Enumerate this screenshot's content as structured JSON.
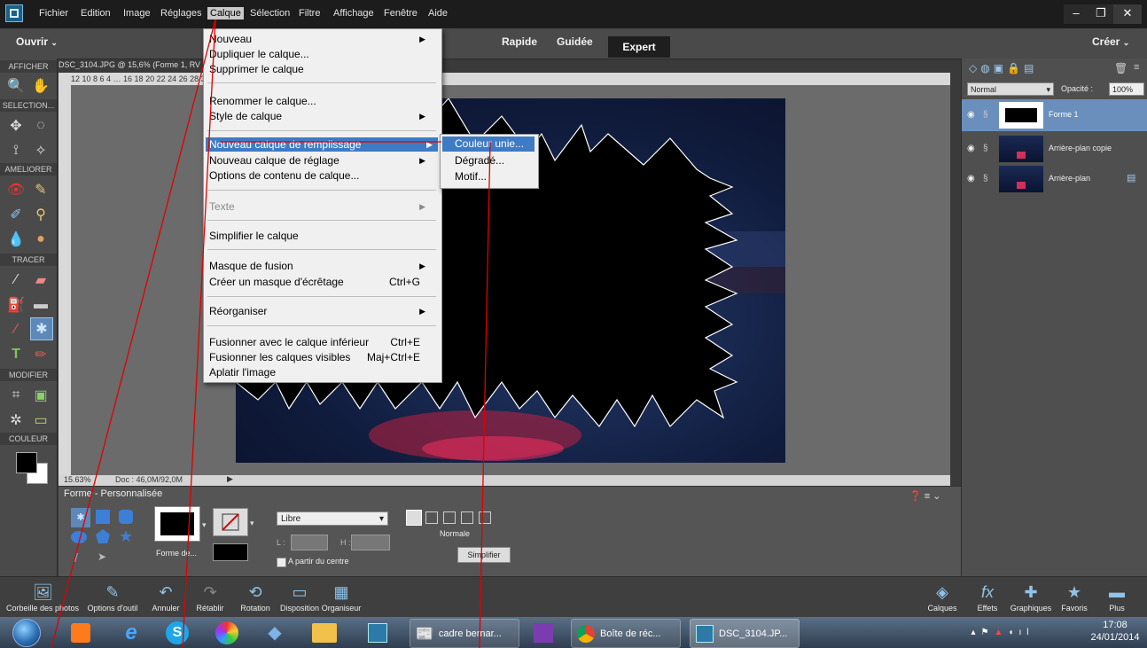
{
  "menubar": {
    "items": [
      "Fichier",
      "Edition",
      "Image",
      "Réglages",
      "Calque",
      "Sélection",
      "Filtre",
      "Affichage",
      "Fenêtre",
      "Aide"
    ],
    "active": "Calque"
  },
  "modebar": {
    "open_label": "Ouvrir",
    "modes": [
      "Rapide",
      "Guidée",
      "Expert"
    ],
    "create_label": "Créer"
  },
  "toolbox": {
    "sections": [
      "AFFICHER",
      "SELECTION...",
      "AMELIORER",
      "TRACER",
      "MODIFIER",
      "COULEUR"
    ]
  },
  "document": {
    "tab_title": "DSC_3104.JPG @ 15,6% (Forme 1, RV",
    "ruler_top": "12 10 8 6 4 … 16 18 20 22 24 26 28 30 32 34 36 38 40 42 44 46 48 50 52",
    "zoom": "15.63%",
    "doc_info": "Doc : 46,0M/92,0M"
  },
  "calque_menu": {
    "items": [
      {
        "label": "Nouveau",
        "arrow": true
      },
      {
        "label": "Dupliquer le calque..."
      },
      {
        "label": "Supprimer le calque"
      },
      {
        "label": "Renommer le calque..."
      },
      {
        "label": "Style de calque",
        "arrow": true
      },
      {
        "label": "Nouveau calque de remplissage",
        "arrow": true,
        "highlight": true
      },
      {
        "label": "Nouveau calque de réglage",
        "arrow": true
      },
      {
        "label": "Options de contenu de calque..."
      },
      {
        "label": "Texte",
        "arrow": true,
        "disabled": true
      },
      {
        "label": "Simplifier le calque"
      },
      {
        "label": "Masque de fusion",
        "arrow": true
      },
      {
        "label": "Créer un masque d'écrêtage",
        "shortcut": "Ctrl+G"
      },
      {
        "label": "Réorganiser",
        "arrow": true
      },
      {
        "label": "Fusionner avec le calque inférieur",
        "shortcut": "Ctrl+E"
      },
      {
        "label": "Fusionner les calques visibles",
        "shortcut": "Maj+Ctrl+E"
      },
      {
        "label": "Aplatir l'image"
      }
    ]
  },
  "fill_submenu": {
    "items": [
      "Couleur unie...",
      "Dégradé...",
      "Motif..."
    ],
    "highlight": "Couleur unie..."
  },
  "layers": {
    "blend_mode": "Normal",
    "opacity_label": "Opacité :",
    "opacity_value": "100%",
    "rows": [
      {
        "name": "Forme 1",
        "selected": true
      },
      {
        "name": "Arrière-plan copie"
      },
      {
        "name": "Arrière-plan"
      }
    ]
  },
  "options_panel": {
    "title": "Forme - Personnalisée",
    "shape_label": "Forme de...",
    "constraint": "Libre",
    "w_label": "L :",
    "h_label": "H :",
    "from_center": "A partir du centre",
    "mode_label": "Normale",
    "simplify": "Simplifier"
  },
  "actionbar": {
    "left": [
      "Corbeille des photos",
      "Options d'outil",
      "Annuler",
      "Rétablir",
      "Rotation",
      "Disposition",
      "Organiseur"
    ],
    "right": [
      "Calques",
      "Effets",
      "Graphiques",
      "Favoris",
      "Plus"
    ]
  },
  "taskbar": {
    "windows": [
      "cadre bernar...",
      "Boîte de réc...",
      "DSC_3104.JP..."
    ],
    "time": "17:08",
    "date": "24/01/2014"
  },
  "colors": {
    "accent": "#3d7bc4",
    "annotation": "#e00000"
  }
}
